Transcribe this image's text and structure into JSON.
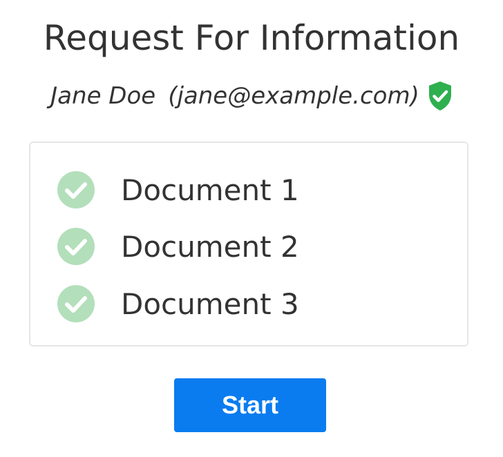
{
  "header": {
    "title": "Request For Information"
  },
  "user": {
    "name": "Jane Doe",
    "email": "(jane@example.com)",
    "verified_icon": "shield-check-icon"
  },
  "documents": {
    "items": [
      {
        "label": "Document 1",
        "icon": "check-circle-icon",
        "completed": true
      },
      {
        "label": "Document 2",
        "icon": "check-circle-icon",
        "completed": true
      },
      {
        "label": "Document 3",
        "icon": "check-circle-icon",
        "completed": true
      }
    ]
  },
  "actions": {
    "start_label": "Start"
  },
  "colors": {
    "accent": "#0a7cf0",
    "verified": "#2eb04f",
    "check_done": "#b3dfbb",
    "text": "#333333",
    "border": "#e6e6e6"
  }
}
